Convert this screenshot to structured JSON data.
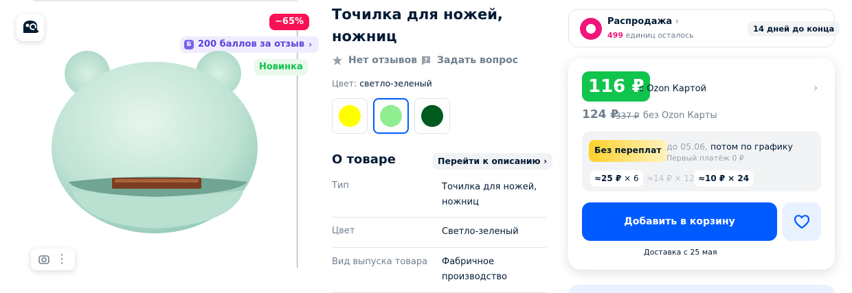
{
  "gallery": {
    "discount_badge": "−65%",
    "points_badge": "200 баллов за отзыв",
    "points_icon": "Б",
    "new_badge": "Новинка",
    "image_alt": "Точилка для ножей светло-зеленая"
  },
  "product": {
    "title": "Точилка для ножей, ножниц",
    "reviews": "Нет отзывов",
    "ask": "Задать вопрос",
    "color_label": "Цвет:",
    "color_value": "светло-зеленый",
    "swatches": [
      {
        "name": "yellow",
        "color": "#ffff00"
      },
      {
        "name": "light-green",
        "color": "#90ee90",
        "selected": true
      },
      {
        "name": "dark-green",
        "color": "#005a1e"
      }
    ]
  },
  "about": {
    "title": "О товаре",
    "goto_label": "Перейти к описанию",
    "specs": [
      {
        "key": "Тип",
        "value": "Точилка для ножей, ножниц"
      },
      {
        "key": "Цвет",
        "value": "Светло-зеленый"
      },
      {
        "key": "Вид выпуска товара",
        "value": "Фабричное производство"
      }
    ]
  },
  "sale": {
    "title": "Распродажа",
    "units_count": "499",
    "units_text": "единиц осталось",
    "days_left": "14 дней до конца"
  },
  "price": {
    "card_price": "116 ₽",
    "with_card": "с Ozon Картой",
    "regular_price": "124 ₽",
    "old_price": "337 ₽",
    "without_card": "без Ozon Карты"
  },
  "installment": {
    "badge": "Без переплат",
    "until": "до 05.06,",
    "then": "потом по графику",
    "first_payment": "Первый платёж 0 ₽",
    "options": [
      {
        "amount": "≈25 ₽",
        "times": "× 6",
        "dim": false
      },
      {
        "amount": "≈14 ₽",
        "times": "× 12",
        "dim": true
      },
      {
        "amount": "≈10 ₽",
        "times": "× 24",
        "dim": false
      }
    ]
  },
  "actions": {
    "add_to_cart": "Добавить в корзину",
    "delivery": "Доставка с 25 мая"
  }
}
